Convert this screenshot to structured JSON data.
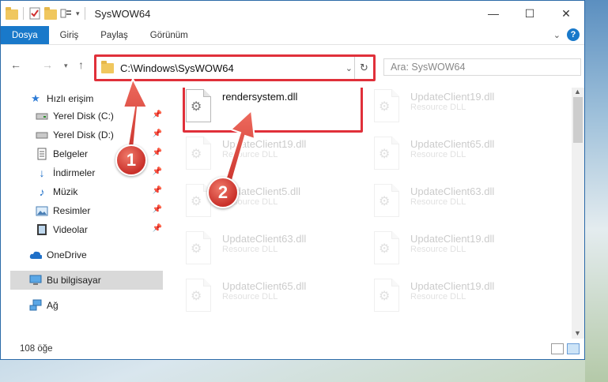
{
  "window": {
    "title": "SysWOW64",
    "controls": {
      "minimize": "—",
      "maximize": "☐",
      "close": "✕"
    }
  },
  "ribbon": {
    "tabs": [
      "Dosya",
      "Giriş",
      "Paylaş",
      "Görünüm"
    ],
    "active_tab": "Dosya",
    "help": "?"
  },
  "address": {
    "path": "C:\\Windows\\SysWOW64"
  },
  "search": {
    "placeholder": "Ara: SysWOW64"
  },
  "nav": {
    "quick_access": "Hızlı erişim",
    "items": [
      {
        "label": "Yerel Disk (C:)",
        "icon": "drive-icon",
        "pinned": true
      },
      {
        "label": "Yerel Disk (D:)",
        "icon": "drive-icon",
        "pinned": true
      },
      {
        "label": "Belgeler",
        "icon": "documents-icon",
        "pinned": true
      },
      {
        "label": "İndirmeler",
        "icon": "download-icon",
        "pinned": true
      },
      {
        "label": "Müzik",
        "icon": "music-icon",
        "pinned": true
      },
      {
        "label": "Resimler",
        "icon": "pictures-icon",
        "pinned": true
      },
      {
        "label": "Videolar",
        "icon": "videos-icon",
        "pinned": true
      }
    ],
    "onedrive": "OneDrive",
    "this_pc": "Bu bilgisayar",
    "network": "Ağ"
  },
  "files": [
    {
      "name": "rendersystem.dll",
      "desc": "",
      "highlighted": true
    },
    {
      "name": "UpdateClient19.dll",
      "desc": "Resource DLL"
    },
    {
      "name": "UpdateClient19.dll",
      "desc": "Resource DLL"
    },
    {
      "name": "UpdateClient65.dll",
      "desc": "Resource DLL"
    },
    {
      "name": "UpdateClient5.dll",
      "desc": "Resource DLL"
    },
    {
      "name": "UpdateClient63.dll",
      "desc": "Resource DLL"
    },
    {
      "name": "UpdateClient63.dll",
      "desc": "Resource DLL"
    },
    {
      "name": "UpdateClient19.dll",
      "desc": "Resource DLL"
    },
    {
      "name": "UpdateClient65.dll",
      "desc": "Resource DLL"
    },
    {
      "name": "UpdateClient19.dll",
      "desc": "Resource DLL"
    }
  ],
  "status": {
    "item_count": "108 öğe"
  },
  "annotations": {
    "step1": "1",
    "step2": "2",
    "color": "#e0303a"
  }
}
